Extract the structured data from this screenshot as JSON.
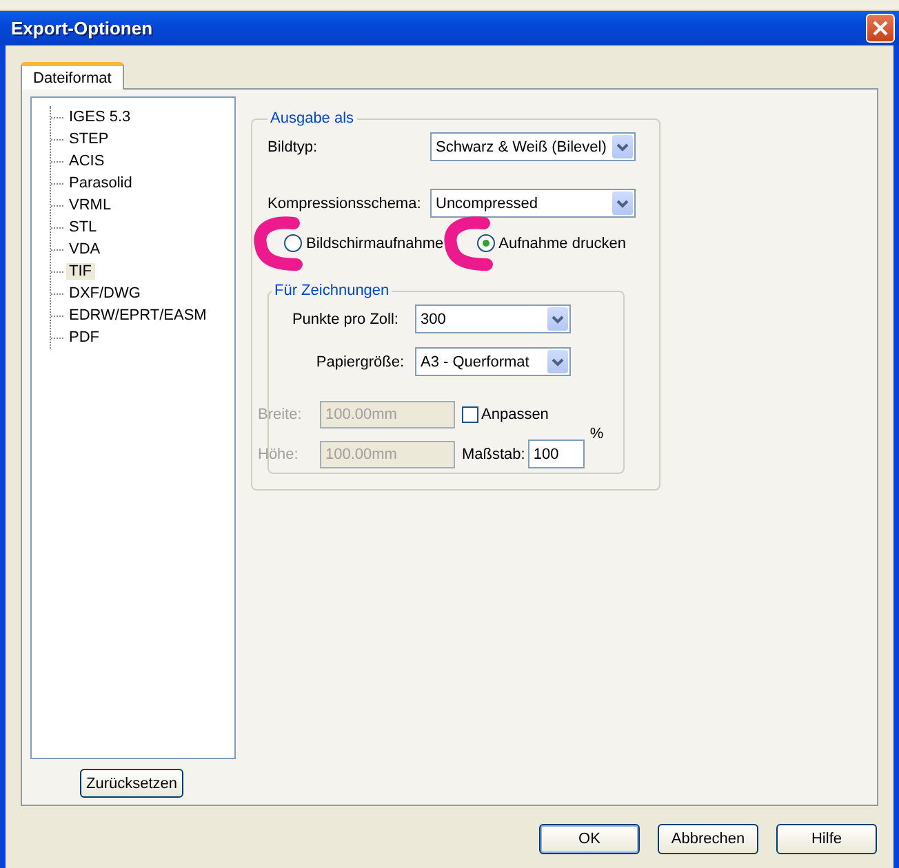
{
  "window": {
    "title": "Export-Optionen"
  },
  "tabs": [
    {
      "label": "Dateiformat",
      "selected": true
    }
  ],
  "tree": {
    "items": [
      {
        "label": "IGES 5.3",
        "selected": false
      },
      {
        "label": "STEP",
        "selected": false
      },
      {
        "label": "ACIS",
        "selected": false
      },
      {
        "label": "Parasolid",
        "selected": false
      },
      {
        "label": "VRML",
        "selected": false
      },
      {
        "label": "STL",
        "selected": false
      },
      {
        "label": "VDA",
        "selected": false
      },
      {
        "label": "TIF",
        "selected": true
      },
      {
        "label": "DXF/DWG",
        "selected": false
      },
      {
        "label": "EDRW/EPRT/EASM",
        "selected": false
      },
      {
        "label": "PDF",
        "selected": false
      }
    ]
  },
  "reset_button": "Zurücksetzen",
  "output_group": {
    "title": "Ausgabe als",
    "image_type": {
      "label": "Bildtyp:",
      "value": "Schwarz & Weiß (Bilevel)"
    },
    "compression": {
      "label": "Kompressionsschema:",
      "value": "Uncompressed"
    },
    "radios": [
      {
        "label": "Bildschirmaufnahme",
        "selected": false
      },
      {
        "label": "Aufnahme drucken",
        "selected": true
      }
    ],
    "drawings_group": {
      "title": "Für Zeichnungen",
      "dpi": {
        "label": "Punkte pro Zoll:",
        "value": "300"
      },
      "paper": {
        "label": "Papiergröße:",
        "value": "A3 - Querformat"
      },
      "width": {
        "label": "Breite:",
        "value": "100.00mm",
        "disabled": true
      },
      "height": {
        "label": "Höhe:",
        "value": "100.00mm",
        "disabled": true
      },
      "fit": {
        "label": "Anpassen",
        "checked": false
      },
      "scale": {
        "label": "Maßstab:",
        "value": "100",
        "unit": "%"
      }
    }
  },
  "buttons": [
    "OK",
    "Abbrechen",
    "Hilfe"
  ]
}
